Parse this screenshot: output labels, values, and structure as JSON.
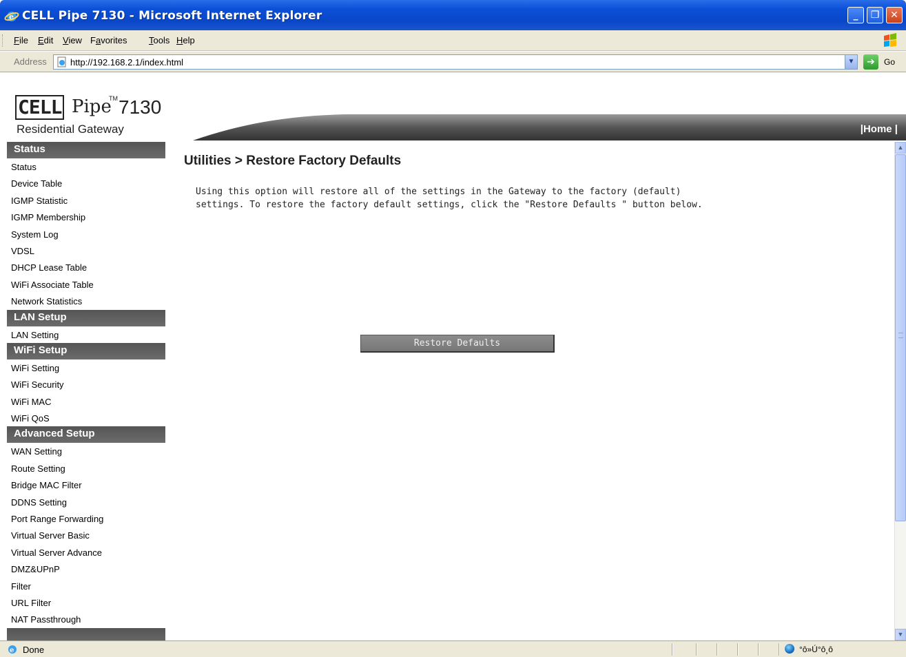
{
  "window": {
    "title": "CELL Pipe 7130 - Microsoft Internet Explorer"
  },
  "menu": [
    {
      "label": "File",
      "ul": "F"
    },
    {
      "label": "Edit",
      "ul": "E"
    },
    {
      "label": "View",
      "ul": "V"
    },
    {
      "label": "Favorites",
      "ul": "a"
    },
    {
      "label": "Tools",
      "ul": "T"
    },
    {
      "label": "Help",
      "ul": "H"
    }
  ],
  "address": {
    "label": "Address",
    "url": "http://192.168.2.1/index.html",
    "go": "Go"
  },
  "logo": {
    "cell": "CELL",
    "pipe": "Pipe",
    "tm": "TM",
    "model": "7130",
    "subtitle": "Residential Gateway"
  },
  "header": {
    "home": "|Home |"
  },
  "sidebar": [
    {
      "type": "head",
      "label": "Status"
    },
    {
      "type": "item",
      "label": "Status"
    },
    {
      "type": "item",
      "label": "Device Table"
    },
    {
      "type": "item",
      "label": "IGMP Statistic"
    },
    {
      "type": "item",
      "label": "IGMP Membership"
    },
    {
      "type": "item",
      "label": "System Log"
    },
    {
      "type": "item",
      "label": "VDSL"
    },
    {
      "type": "item",
      "label": "DHCP Lease Table"
    },
    {
      "type": "item",
      "label": "WiFi Associate Table"
    },
    {
      "type": "item",
      "label": "Network Statistics"
    },
    {
      "type": "head",
      "label": "LAN Setup"
    },
    {
      "type": "item",
      "label": "LAN Setting"
    },
    {
      "type": "head",
      "label": "WiFi Setup"
    },
    {
      "type": "item",
      "label": "WiFi Setting"
    },
    {
      "type": "item",
      "label": "WiFi Security"
    },
    {
      "type": "item",
      "label": "WiFi MAC"
    },
    {
      "type": "item",
      "label": "WiFi QoS"
    },
    {
      "type": "head",
      "label": "Advanced Setup"
    },
    {
      "type": "item",
      "label": "WAN Setting"
    },
    {
      "type": "item",
      "label": "Route Setting"
    },
    {
      "type": "item",
      "label": "Bridge MAC Filter"
    },
    {
      "type": "item",
      "label": "DDNS Setting"
    },
    {
      "type": "item",
      "label": "Port Range Forwarding"
    },
    {
      "type": "item",
      "label": "Virtual Server Basic"
    },
    {
      "type": "item",
      "label": "Virtual Server Advance"
    },
    {
      "type": "item",
      "label": "DMZ&UPnP"
    },
    {
      "type": "item",
      "label": "Filter"
    },
    {
      "type": "item",
      "label": "URL Filter"
    },
    {
      "type": "item",
      "label": "NAT Passthrough"
    },
    {
      "type": "head",
      "label": ""
    }
  ],
  "main": {
    "title": "Utilities > Restore Factory Defaults",
    "description": "Using this option will restore all of the settings in the Gateway to the factory (default) settings. To restore the factory default settings, click the \"Restore Defaults \" button below.",
    "button": "Restore Defaults"
  },
  "status": {
    "text": "Done",
    "zone": "°ô»Ú°ô¸ô"
  },
  "colors": {
    "titlebar": "#0b4fd8",
    "sidebar_head": "#5f5f5f",
    "button": "#808080",
    "chrome": "#ece9d8"
  }
}
